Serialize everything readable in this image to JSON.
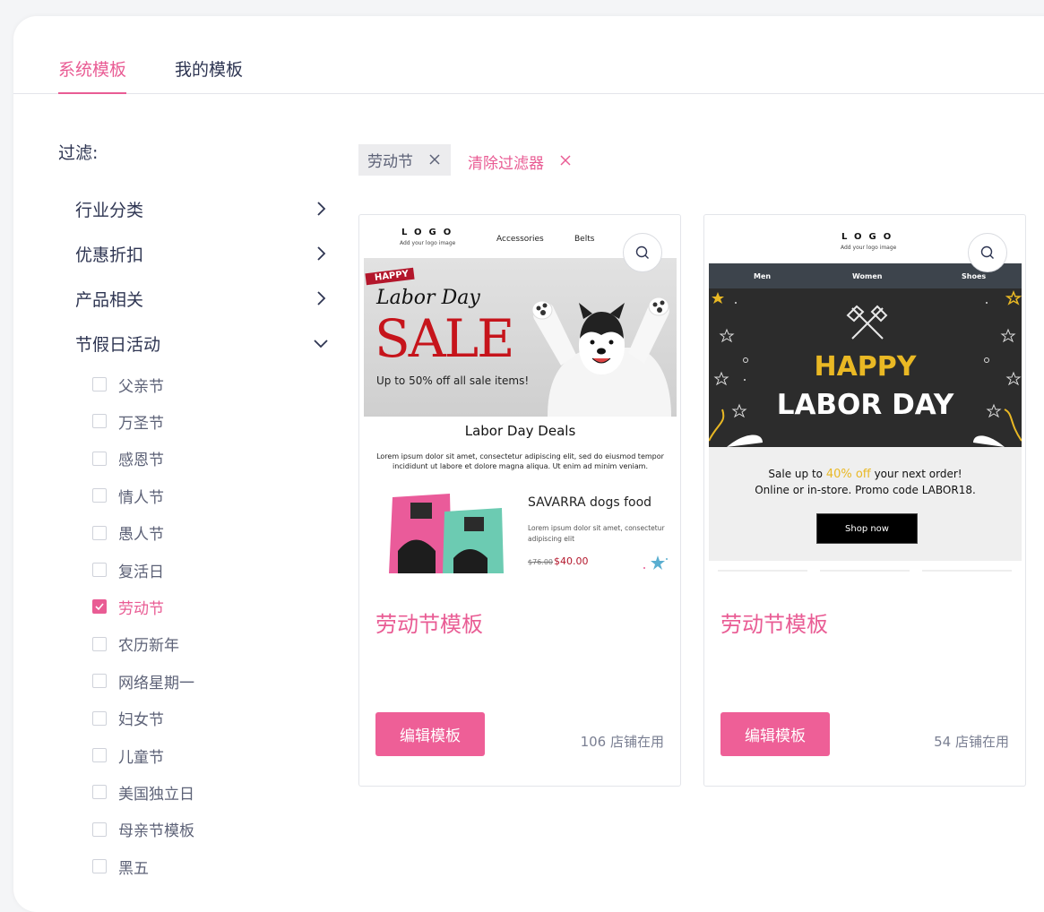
{
  "tabs": {
    "system": "系统模板",
    "mine": "我的模板"
  },
  "filter": {
    "title": "过滤:",
    "categories": [
      {
        "label": "行业分类",
        "expanded": false
      },
      {
        "label": "优惠折扣",
        "expanded": false
      },
      {
        "label": "产品相关",
        "expanded": false
      },
      {
        "label": "节假日活动",
        "expanded": true
      }
    ],
    "holiday_options": [
      {
        "label": "父亲节",
        "checked": false
      },
      {
        "label": "万圣节",
        "checked": false
      },
      {
        "label": "感恩节",
        "checked": false
      },
      {
        "label": "情人节",
        "checked": false
      },
      {
        "label": "愚人节",
        "checked": false
      },
      {
        "label": "复活日",
        "checked": false
      },
      {
        "label": "劳动节",
        "checked": true
      },
      {
        "label": "农历新年",
        "checked": false
      },
      {
        "label": "网络星期一",
        "checked": false
      },
      {
        "label": "妇女节",
        "checked": false
      },
      {
        "label": "儿童节",
        "checked": false
      },
      {
        "label": "美国独立日",
        "checked": false
      },
      {
        "label": "母亲节模板",
        "checked": false
      },
      {
        "label": "黑五",
        "checked": false
      }
    ]
  },
  "active_filters": {
    "chip": "劳动节",
    "clear": "清除过滤器"
  },
  "accent_color": "#e95c94",
  "cards": [
    {
      "name": "劳动节模板",
      "edit": "编辑模板",
      "usage": "106 店铺在用",
      "preview": {
        "logo": "LOGO",
        "logo_sub": "Add your logo image",
        "nav": [
          "Accessories",
          "Belts"
        ],
        "banner_tag": "HAPPY",
        "banner_title": "Labor Day",
        "banner_sale": "SALE",
        "banner_sub": "Up to 50% off all sale items!",
        "heading": "Labor Day Deals",
        "body": "Lorem ipsum dolor sit amet, consectetur adipiscing elit, sed do eiusmod tempor incididunt ut labore et dolore magna aliqua. Ut enim ad minim veniam.",
        "product_name": "SAVARRA dogs food",
        "product_desc": "Lorem ipsum dolor sit amet, consectetur adipiscing elit",
        "old_price": "$76.00",
        "new_price": "$40.00"
      }
    },
    {
      "name": "劳动节模板",
      "edit": "编辑模板",
      "usage": "54 店铺在用",
      "preview": {
        "logo": "LOGO",
        "logo_sub": "Add your logo image",
        "nav": [
          "Men",
          "Women",
          "Shoes"
        ],
        "happy": "HAPPY",
        "labor": "LABOR DAY",
        "promo_pre": "Sale up to ",
        "promo_pct": "40% off",
        "promo_post": " your next order!",
        "promo_line2": "Online or in-store. Promo code LABOR18.",
        "cta": "Shop now"
      }
    }
  ]
}
